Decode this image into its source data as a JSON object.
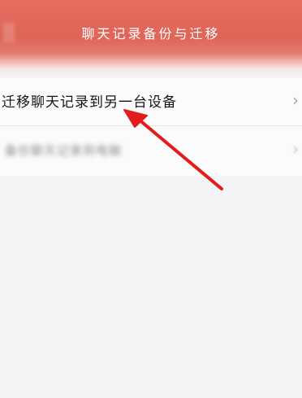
{
  "header": {
    "title": "聊天记录备份与迁移",
    "back_icon": "back-icon",
    "color": "#e16a5c"
  },
  "settings": {
    "items": [
      {
        "label": "迁移聊天记录到另一台设备",
        "icon": "chevron-right-icon"
      },
      {
        "label": "备份聊天记录到电脑",
        "icon": "chevron-right-icon"
      }
    ]
  },
  "annotation": {
    "color": "#e31b1b",
    "icon": "red-arrow-pointer"
  },
  "chevron_glyph": "›"
}
